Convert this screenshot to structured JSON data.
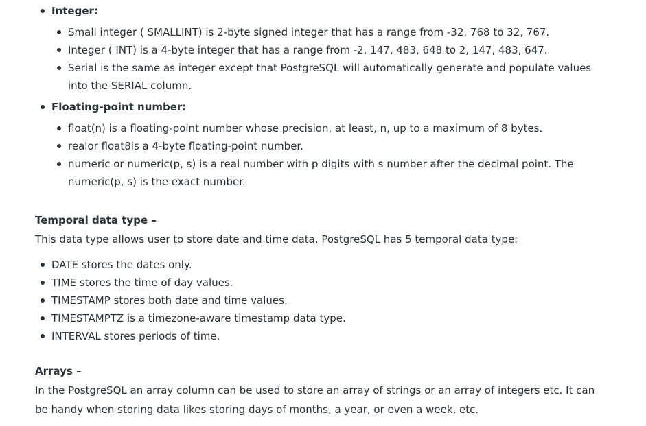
{
  "sections": {
    "integer": {
      "heading": "Integer:",
      "items": [
        "Small integer ( SMALLINT) is 2-byte signed integer that has a range from -32, 768 to 32, 767.",
        "Integer ( INT) is a 4-byte integer that has a range from -2, 147, 483, 648 to 2, 147, 483, 647.",
        "Serial is the same as integer except that PostgreSQL will automatically generate and populate values",
        "into the SERIAL column."
      ]
    },
    "floating": {
      "heading": "Floating-point number:",
      "items": [
        "float(n) is a floating-point number whose precision, at least, n, up to a maximum of 8 bytes.",
        "realor float8is a 4-byte floating-point number.",
        "numeric or numeric(p, s) is a real number with p digits with s number after the decimal point. The",
        "numeric(p, s) is the exact number."
      ]
    },
    "temporal": {
      "heading": "Temporal data type –",
      "intro": "This data type allows user to store date and time data. PostgreSQL has 5 temporal data type:",
      "items": [
        "DATE stores the dates only.",
        "TIME stores the time of day values.",
        "TIMESTAMP stores both date and time values.",
        "TIMESTAMPTZ is a timezone-aware timestamp data type.",
        "INTERVAL stores periods of time."
      ]
    },
    "arrays": {
      "heading": "Arrays –",
      "lines": [
        "In the PostgreSQL an array column can be used to store an array of strings or an array of integers etc. It can",
        "be handy when storing data likes storing days of months, a year, or even a week, etc."
      ]
    }
  }
}
